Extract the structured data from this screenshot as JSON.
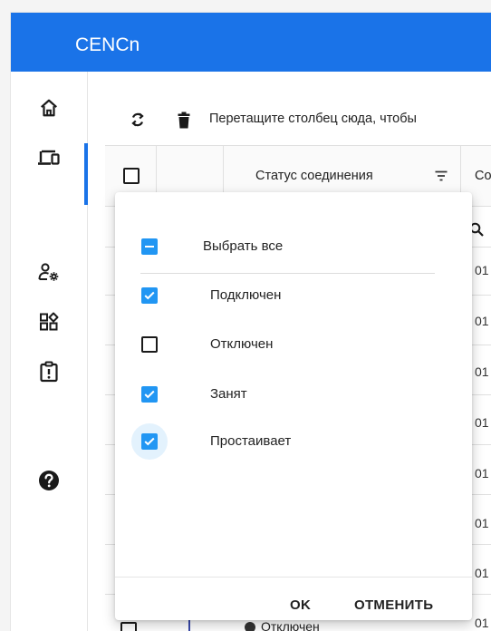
{
  "app": {
    "title": "CENCn"
  },
  "sidebar": {
    "items": [
      {
        "name": "home-icon"
      },
      {
        "name": "devices-icon",
        "active": true
      },
      {
        "name": "users-settings-icon"
      },
      {
        "name": "apps-icon"
      },
      {
        "name": "alert-report-icon"
      },
      {
        "name": "help-icon"
      }
    ]
  },
  "toolbar": {
    "group_hint": "Перетащите столбец сюда, чтобы"
  },
  "grid": {
    "columns": [
      {
        "label": "Статус соединения"
      },
      {
        "label": "Со"
      }
    ],
    "row_values": [
      "01",
      "01",
      "01",
      "01",
      "01",
      "01",
      "01",
      "01"
    ],
    "last_row_status": "Отключен"
  },
  "filter_popup": {
    "select_all_label": "Выбрать все",
    "select_all_state": "indeterminate",
    "options": [
      {
        "label": "Подключен",
        "checked": true
      },
      {
        "label": "Отключен",
        "checked": false
      },
      {
        "label": "Занят",
        "checked": true
      },
      {
        "label": "Простаивает",
        "checked": true
      }
    ],
    "ok_label": "OK",
    "cancel_label": "ОТМЕНИТЬ"
  },
  "colors": {
    "accent": "#1a73e8",
    "checkbox": "#2196f3",
    "focus_halo": "#e3f2fd"
  }
}
